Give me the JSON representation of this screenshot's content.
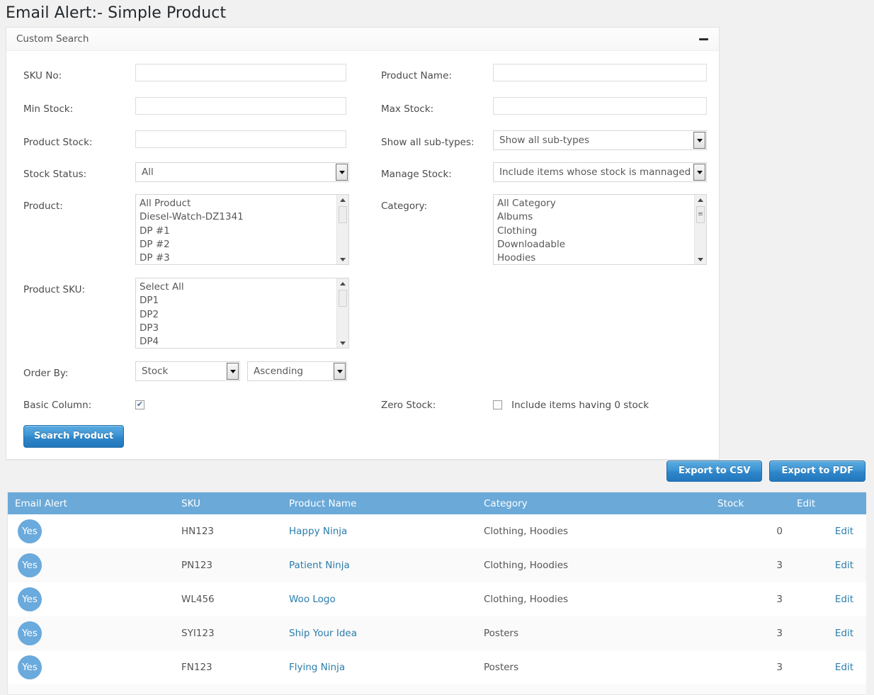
{
  "page": {
    "title": "Email Alert:- Simple Product"
  },
  "panel": {
    "title": "Custom Search",
    "toggle_icon": "minus-icon"
  },
  "form": {
    "sku_no": {
      "label": "SKU No:",
      "value": "",
      "placeholder": ""
    },
    "product_name": {
      "label": "Product Name:",
      "value": "",
      "placeholder": ""
    },
    "min_stock": {
      "label": "Min Stock:",
      "value": "",
      "placeholder": ""
    },
    "max_stock": {
      "label": "Max Stock:",
      "value": "",
      "placeholder": ""
    },
    "product_stock": {
      "label": "Product Stock:",
      "value": "",
      "placeholder": ""
    },
    "show_sub_types": {
      "label": "Show all sub-types:",
      "value": "Show all sub-types",
      "options": [
        "Show all sub-types"
      ]
    },
    "stock_status": {
      "label": "Stock Status:",
      "value": "All",
      "options": [
        "All"
      ]
    },
    "manage_stock": {
      "label": "Manage Stock:",
      "value": "Include items whose stock is mannaged",
      "options": [
        "Include items whose stock is mannaged"
      ]
    },
    "product": {
      "label": "Product:",
      "options": [
        "All Product",
        "Diesel-Watch-DZ1341",
        "DP #1",
        "DP #2",
        "DP #3"
      ]
    },
    "category": {
      "label": "Category:",
      "options": [
        "All Category",
        "Albums",
        "Clothing",
        "Downloadable",
        "Hoodies"
      ]
    },
    "product_sku": {
      "label": "Product SKU:",
      "options": [
        "Select All",
        "DP1",
        "DP2",
        "DP3",
        "DP4"
      ]
    },
    "order_by": {
      "label": "Order By:",
      "field_value": "Stock",
      "field_options": [
        "Stock"
      ],
      "direction_value": "Ascending",
      "direction_options": [
        "Ascending"
      ]
    },
    "basic_column": {
      "label": "Basic Column:",
      "checked": true
    },
    "zero_stock": {
      "label": "Zero Stock:",
      "checkbox_label": "Include items having 0 stock",
      "checked": false
    },
    "search_button": "Search Product"
  },
  "exports": {
    "csv": "Export to CSV",
    "pdf": "Export to PDF"
  },
  "table": {
    "columns": [
      "Email Alert",
      "SKU",
      "Product Name",
      "Category",
      "Stock",
      "Edit"
    ],
    "rows": [
      {
        "alert": "Yes",
        "sku": "HN123",
        "name": "Happy Ninja",
        "category": "Clothing, Hoodies",
        "stock": "0",
        "edit": "Edit"
      },
      {
        "alert": "Yes",
        "sku": "PN123",
        "name": "Patient Ninja",
        "category": "Clothing, Hoodies",
        "stock": "3",
        "edit": "Edit"
      },
      {
        "alert": "Yes",
        "sku": "WL456",
        "name": "Woo Logo",
        "category": "Clothing, Hoodies",
        "stock": "3",
        "edit": "Edit"
      },
      {
        "alert": "Yes",
        "sku": "SYI123",
        "name": "Ship Your Idea",
        "category": "Posters",
        "stock": "3",
        "edit": "Edit"
      },
      {
        "alert": "Yes",
        "sku": "FN123",
        "name": "Flying Ninja",
        "category": "Posters",
        "stock": "3",
        "edit": "Edit"
      }
    ]
  },
  "colors": {
    "accent_blue": "#6aa9d8",
    "button_blue": "#2f86c9",
    "link_blue": "#2b7dab",
    "page_bg": "#f1f1f1"
  }
}
